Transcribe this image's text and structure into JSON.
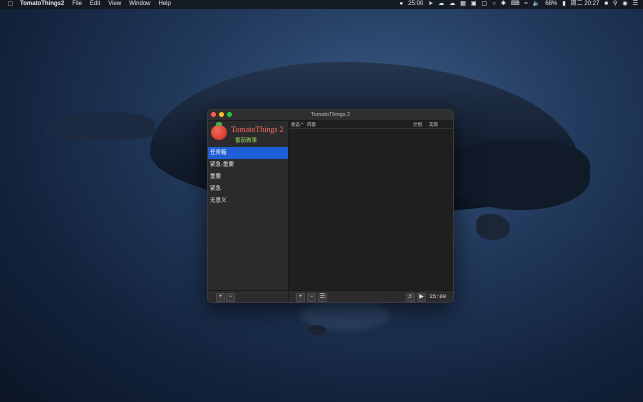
{
  "menubar": {
    "app_name": "TomatoThings2",
    "menus": [
      "File",
      "Edit",
      "View",
      "Window",
      "Help"
    ],
    "status_timer": "25:00",
    "battery": "68%",
    "clock": "周二 20:27"
  },
  "window": {
    "title": "TomatoThings 2",
    "app_title": "TomatoThings 2",
    "app_subtitle": "番茄做事",
    "categories": [
      {
        "label": "任务箱",
        "selected": true
      },
      {
        "label": "紧急-重要",
        "selected": false
      },
      {
        "label": "重要",
        "selected": false
      },
      {
        "label": "紧急",
        "selected": false
      },
      {
        "label": "无意义",
        "selected": false
      }
    ],
    "columns": {
      "status": "状态 ^",
      "content": "内容",
      "plan": "计划",
      "actual": "实际"
    },
    "timer": "25:00"
  },
  "colors": {
    "accent": "#1f5fd6",
    "tomato": "#d94436",
    "title_red": "#ff6b5c",
    "subtitle_green": "#9fd35a"
  }
}
